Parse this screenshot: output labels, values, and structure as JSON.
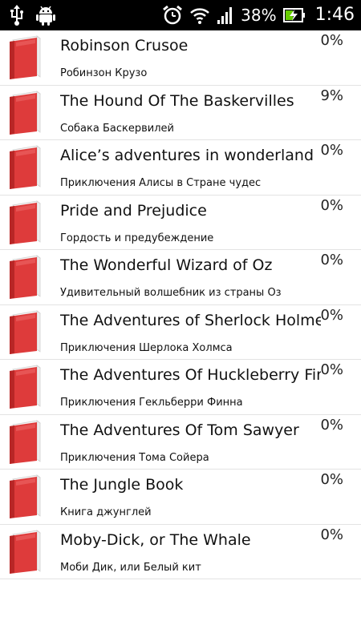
{
  "status_bar": {
    "icons": [
      "usb-icon",
      "android-debug-icon",
      "alarm-icon",
      "wifi-icon",
      "signal-icon",
      "battery-charging-icon"
    ],
    "battery_percent": "38%",
    "time": "1:46"
  },
  "colors": {
    "book_cover": "#e03a3a",
    "book_pages": "#f2f2f2",
    "divider": "#e3e3e3"
  },
  "books": [
    {
      "title": "Robinson Crusoe",
      "subtitle": "Робинзон Крузо",
      "progress": "0%"
    },
    {
      "title": "The Hound Of The Baskervilles",
      "subtitle": "Собака Баскервилей",
      "progress": "9%"
    },
    {
      "title": "Alice’s adventures in wonderland",
      "subtitle": "Приключения Алисы в Стране чудес",
      "progress": "0%"
    },
    {
      "title": "Pride and Prejudice",
      "subtitle": "Гордость и предубеждение",
      "progress": "0%"
    },
    {
      "title": "The Wonderful Wizard of Oz",
      "subtitle": "Удивительный волшебник из страны Оз",
      "progress": "0%"
    },
    {
      "title": "The Adventures of Sherlock Holmes",
      "subtitle": "Приключения Шерлока Холмса",
      "progress": "0%"
    },
    {
      "title": "The Adventures Of Huckleberry Finn",
      "subtitle": "Приключения Гекльберри Финна",
      "progress": "0%"
    },
    {
      "title": "The Adventures Of Tom Sawyer",
      "subtitle": "Приключения Тома Сойера",
      "progress": "0%"
    },
    {
      "title": "The Jungle Book",
      "subtitle": "Книга джунглей",
      "progress": "0%"
    },
    {
      "title": "Moby-Dick, or The Whale",
      "subtitle": "Моби Дик, или Белый кит",
      "progress": "0%"
    }
  ]
}
